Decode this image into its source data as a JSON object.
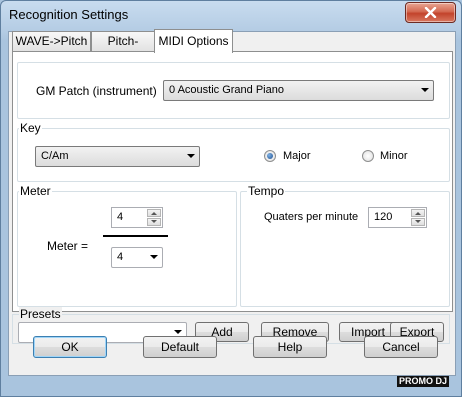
{
  "window": {
    "title": "Recognition Settings"
  },
  "tabs": [
    {
      "label": "WAVE->Pitch"
    },
    {
      "label": "Pitch->MIDI"
    },
    {
      "label": "MIDI Options"
    }
  ],
  "gm": {
    "label": "GM Patch (instrument)",
    "value": "0 Acoustic Grand Piano"
  },
  "key": {
    "group_label": "Key",
    "value": "C/Am",
    "major_label": "Major",
    "minor_label": "Minor",
    "selected": "Major"
  },
  "meter": {
    "group_label": "Meter",
    "label": "Meter  =",
    "numerator": "4",
    "denominator": "4"
  },
  "tempo": {
    "group_label": "Tempo",
    "label": "Quaters per minute",
    "value": "120"
  },
  "presets": {
    "group_label": "Presets",
    "value": "",
    "add": "Add",
    "remove": "Remove",
    "import": "Import",
    "export": "Export"
  },
  "footer": {
    "ok": "OK",
    "default": "Default",
    "help": "Help",
    "cancel": "Cancel"
  },
  "watermark": "PROMO DJ",
  "colors": {
    "close_button": "#c2432b",
    "focus_border": "#3c7fb1",
    "radio_dot": "#1e4f8f"
  }
}
